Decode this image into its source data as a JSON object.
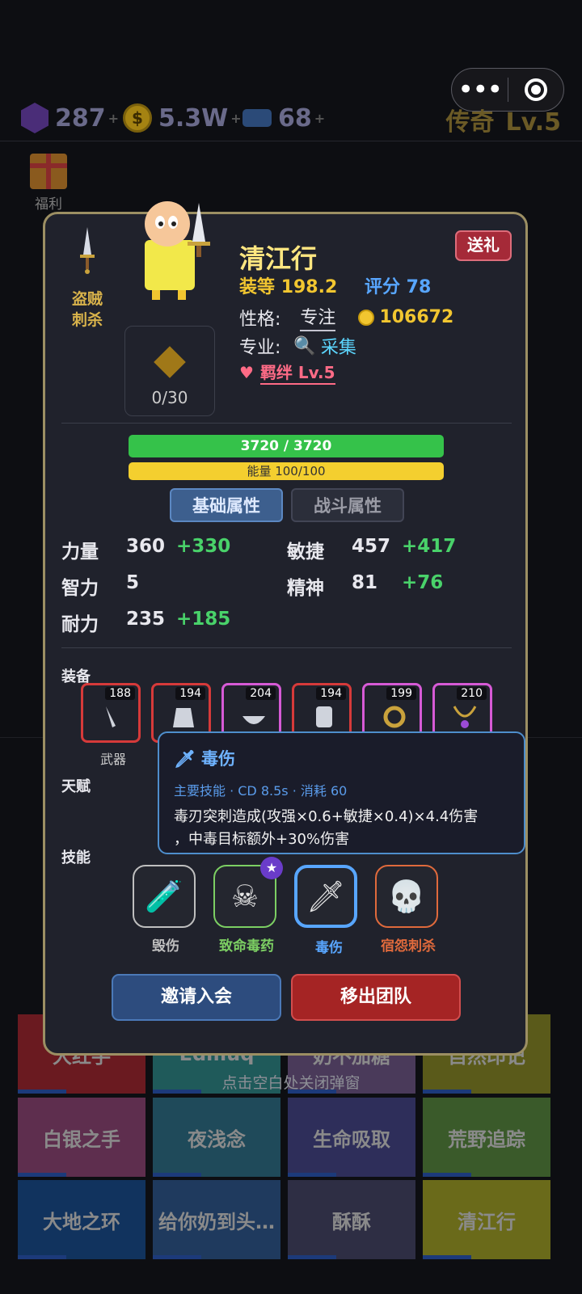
{
  "resources": {
    "gems": "287",
    "coins": "5.3W",
    "tickets": "68",
    "plus": "+"
  },
  "rank": {
    "title": "传奇",
    "level": "Lv.5"
  },
  "sidebar": {
    "welfare": "福利"
  },
  "background_tiles": [
    {
      "label": "大红手"
    },
    {
      "label": "Edmuq"
    },
    {
      "label": "奶不加糖"
    },
    {
      "label": "自然印记"
    },
    {
      "label": "白银之手"
    },
    {
      "label": "夜浅念"
    },
    {
      "label": "生命吸取"
    },
    {
      "label": "荒野追踪"
    },
    {
      "label": "大地之环"
    },
    {
      "label": "给你奶到头…"
    },
    {
      "label": "酥酥"
    },
    {
      "label": "清江行"
    }
  ],
  "close_hint": "点击空白处关闭弹窗",
  "hero": {
    "class_line1": "盗贼",
    "class_line2": "刺杀",
    "name": "清江行",
    "gift_button": "送礼",
    "gear_score_label": "装等",
    "gear_score": "198.2",
    "rating_label": "评分",
    "rating": "78",
    "personality_label": "性格:",
    "personality": "专注",
    "gold": "106672",
    "profession_label": "专业:",
    "profession": "采集",
    "bond": "羁绊 Lv.5",
    "bag": "0/30",
    "hp": "3720 / 3720",
    "energy": "能量 100/100"
  },
  "tabs": {
    "basic": "基础属性",
    "combat": "战斗属性"
  },
  "stats": [
    {
      "name": "力量",
      "value": "360",
      "bonus": "+330"
    },
    {
      "name": "敏捷",
      "value": "457",
      "bonus": "+417"
    },
    {
      "name": "智力",
      "value": "5",
      "bonus": ""
    },
    {
      "name": "精神",
      "value": "81",
      "bonus": "+76"
    },
    {
      "name": "耐力",
      "value": "235",
      "bonus": "+185"
    }
  ],
  "sections": {
    "equipment": "装备",
    "talent": "天赋",
    "skills": "技能"
  },
  "equipment": [
    {
      "level": "188",
      "label": "武器",
      "color": "#d63a3a"
    },
    {
      "level": "194",
      "label": "",
      "color": "#d63a3a"
    },
    {
      "level": "204",
      "label": "",
      "color": "#d65ad6"
    },
    {
      "level": "194",
      "label": "",
      "color": "#d63a3a"
    },
    {
      "level": "199",
      "label": "",
      "color": "#d65ad6"
    },
    {
      "level": "210",
      "label": "",
      "color": "#d65ad6"
    }
  ],
  "tooltip": {
    "title": "毒伤",
    "sub": "主要技能 · CD 8.5s · 消耗 60",
    "desc1": "毒刃突刺造成(攻强×0.6+敏捷×0.4)×4.4伤害",
    "desc2": "，中毒目标额外+30%伤害"
  },
  "skills": [
    {
      "label": "毁伤",
      "color": "#bfbfbf"
    },
    {
      "label": "致命毒药",
      "color": "#7ccf63"
    },
    {
      "label": "毒伤",
      "color": "#58a6ff"
    },
    {
      "label": "宿怨刺杀",
      "color": "#e06a3c"
    }
  ],
  "buttons": {
    "invite": "邀请入会",
    "remove": "移出团队"
  }
}
